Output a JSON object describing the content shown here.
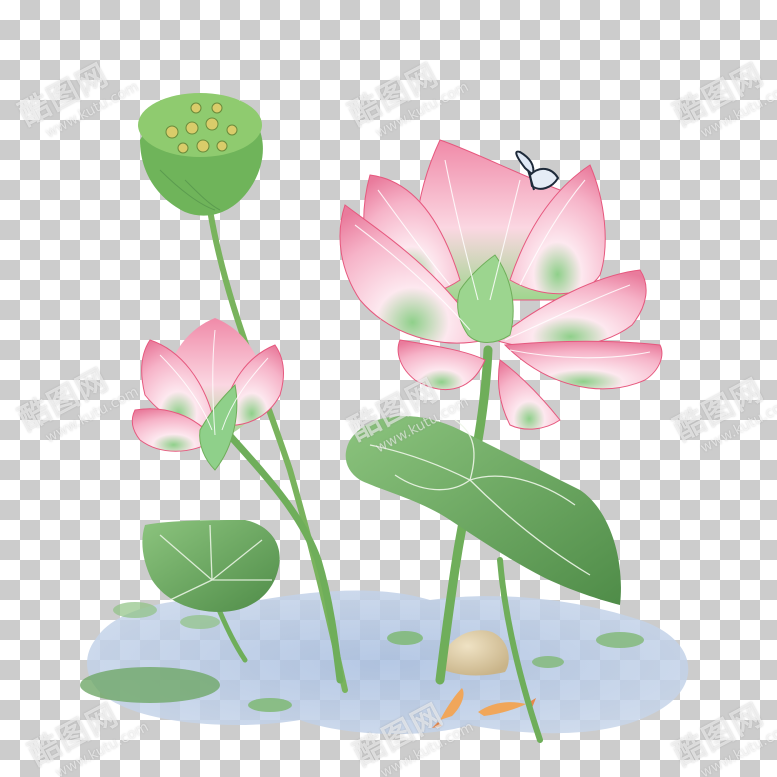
{
  "watermark": {
    "logo": "酷图网",
    "url": "www.kutu.com"
  },
  "palette": {
    "lotus_pink": "#f4a7bf",
    "lotus_pale": "#fde8ef",
    "lotus_edge": "#e6587e",
    "leaf_green": "#6aa55e",
    "leaf_dark": "#3f7a3c",
    "pod_green": "#7fbf5f",
    "water_blue": "#9fb6d8",
    "koi_orange": "#f0a65a"
  },
  "illustration": {
    "subject": "lotus-pond",
    "elements": [
      "lotus-seed-pod",
      "large-lotus-flower",
      "small-lotus-flower",
      "butterfly",
      "lotus-leaves",
      "pond-water",
      "koi-fish",
      "pebble"
    ]
  }
}
